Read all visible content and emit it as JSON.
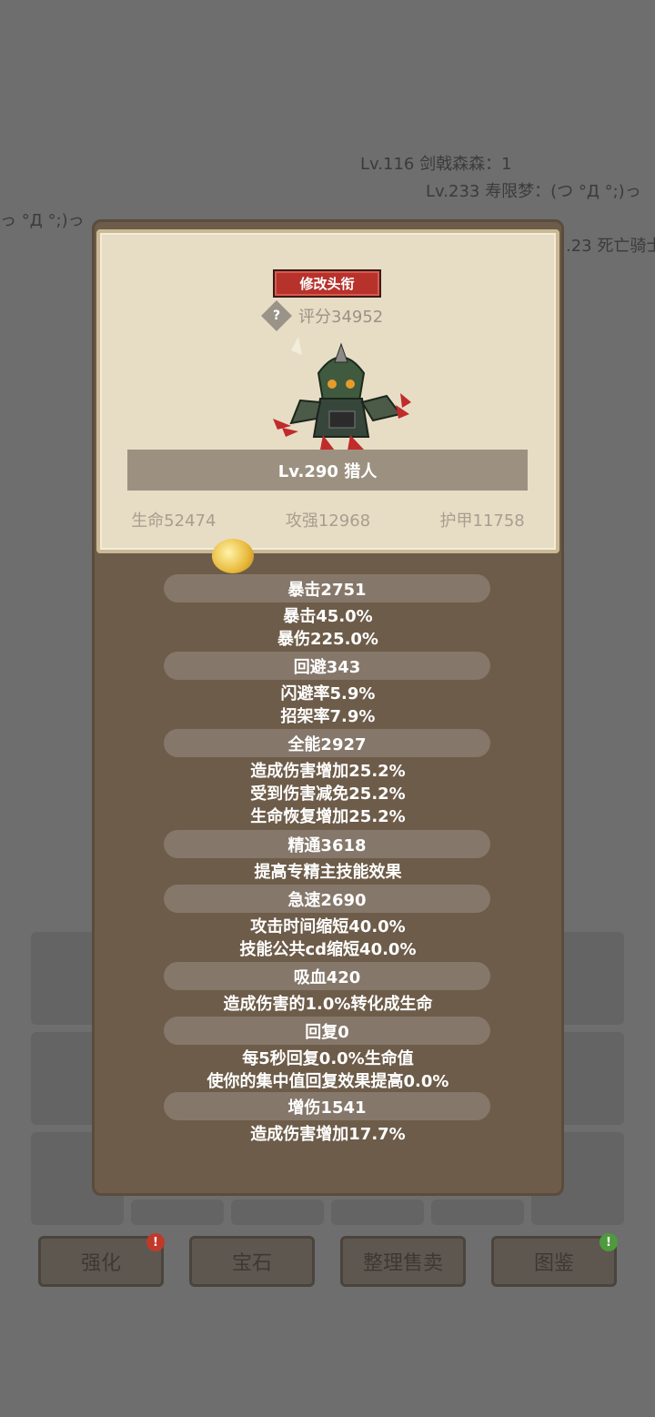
{
  "chat": [
    "Lv.116 剑戟森森：1",
    "Lv.233 寿限梦：(つ °Д °;)っ",
    "っ °Д °;)っ",
    ".23 死亡骑士"
  ],
  "bottom_buttons": [
    "强化",
    "宝石",
    "整理售卖",
    "图鉴"
  ],
  "header": {
    "change_title_label": "修改头衔",
    "help_symbol": "?",
    "score": "评分34952"
  },
  "character": {
    "name_level": "Lv.290 猎人",
    "hp": "生命52474",
    "attack": "攻强12968",
    "armor": "护甲11758"
  },
  "stats": [
    {
      "title": "暴击2751",
      "lines": [
        "暴击45.0%",
        "暴伤225.0%"
      ]
    },
    {
      "title": "回避343",
      "lines": [
        "闪避率5.9%",
        "招架率7.9%"
      ]
    },
    {
      "title": "全能2927",
      "lines": [
        "造成伤害增加25.2%",
        "受到伤害减免25.2%",
        "生命恢复增加25.2%"
      ]
    },
    {
      "title": "精通3618",
      "lines": [
        "提高专精主技能效果"
      ]
    },
    {
      "title": "急速2690",
      "lines": [
        "攻击时间缩短40.0%",
        "技能公共cd缩短40.0%"
      ]
    },
    {
      "title": "吸血420",
      "lines": [
        "造成伤害的1.0%转化成生命"
      ]
    },
    {
      "title": "回复0",
      "lines": [
        "每5秒回复0.0%生命值",
        "使你的集中值回复效果提高0.0%"
      ]
    },
    {
      "title": "增伤1541",
      "lines": [
        "造成伤害增加17.7%"
      ]
    }
  ],
  "badges": {
    "enhance": "!",
    "codex": "!"
  },
  "colors": {
    "badge_red": "#c0392b",
    "badge_green": "#4e9a3d",
    "title_button": "#b8322c",
    "panel": "#6d5c49",
    "card": "#e7ddc5"
  }
}
